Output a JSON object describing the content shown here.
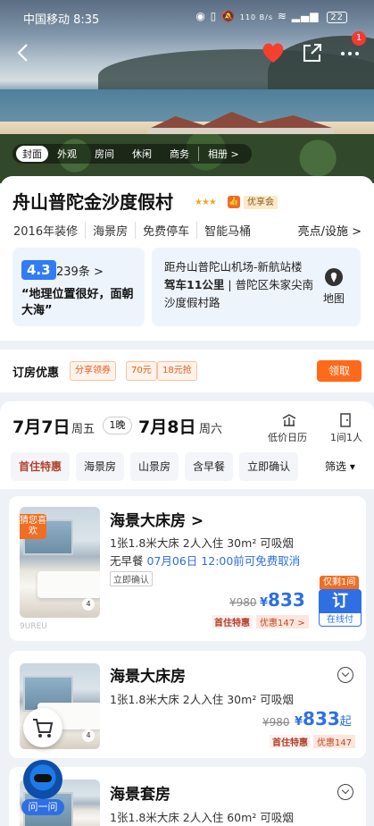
{
  "status_bar": {
    "carrier_time": "中国移动 8:35",
    "net_speed": "110 B/s",
    "battery": "22"
  },
  "nav": {
    "notif_count": "1"
  },
  "photo_tabs": {
    "items": [
      "封面",
      "外观",
      "房间",
      "休闲",
      "商务"
    ],
    "album": "相册 >"
  },
  "hotel": {
    "name": "舟山普陀金沙度假村",
    "stars": "★★★",
    "thumb": "👍",
    "premium": "优享会",
    "features": [
      "2016年装修",
      "海景房",
      "免费停车",
      "智能马桶"
    ],
    "highlights": "亮点/设施 >"
  },
  "review": {
    "score": "4.3",
    "count": "239条  >",
    "quote": "“地理位置很好，面朝大海”"
  },
  "location": {
    "line1": "距舟山普陀山机场-新航站楼",
    "drive": "驾车11公里",
    "address": "普陀区朱家尖南沙度假村路",
    "map_label": "地图"
  },
  "promo": {
    "title": "订房优惠",
    "coupons": [
      "分享领券",
      "70元",
      "18元抢"
    ],
    "claim": "领取"
  },
  "dates": {
    "checkin_date": "7月7日",
    "checkin_week": "周五",
    "nights": "1晚",
    "checkout_date": "7月8日",
    "checkout_week": "周六",
    "calendar": "低价日历",
    "rooms": "1间1人"
  },
  "filters": {
    "chips": [
      "首住特惠",
      "海景房",
      "山景房",
      "含早餐",
      "立即确认"
    ],
    "filter_btn": "筛选 ▾"
  },
  "rooms": [
    {
      "title": "海景大床房 >",
      "tag": "猜您喜欢",
      "beds": "1张1.8米大床  2人入住  30m²  可吸烟",
      "meal": "无早餐",
      "cancel": "07月06日 12:00前可免费取消",
      "confirm": "立即确认",
      "old_price": "¥980",
      "price_symbol": "¥",
      "price": "833",
      "brand": "首住特惠",
      "discount": "优惠147 >",
      "limit": "仅剩1间",
      "book": "订",
      "pay": "在线付",
      "pics": "4",
      "watermark": "9UREU"
    },
    {
      "title": "海景大床房",
      "beds": "1张1.8米大床  2人入住  30m²  可吸烟",
      "old_price": "¥980",
      "price_symbol": "¥",
      "price": "833",
      "price_suffix": "起",
      "brand": "首住特惠",
      "discount": "优惠147",
      "pics": "4"
    },
    {
      "title": "海景套房",
      "beds": "1张1.8米大床  2人入住  60m²  可吸烟"
    }
  ],
  "assistant": {
    "label": "问一问"
  }
}
